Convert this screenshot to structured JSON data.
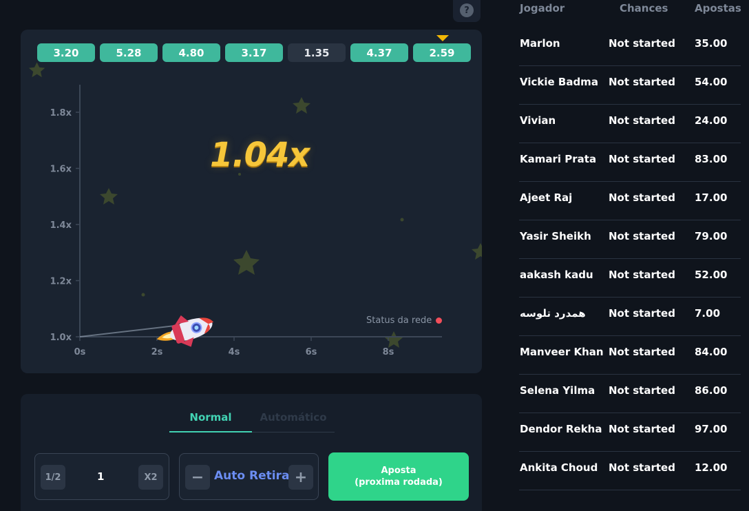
{
  "history": [
    "3.20",
    "5.28",
    "4.80",
    "3.17",
    "1.35",
    "4.37",
    "2.59"
  ],
  "help_label": "?",
  "multiplier": "1.04x",
  "status_label": "Status da rede",
  "chart_data": {
    "type": "line",
    "y_ticks": [
      "1.8x",
      "1.6x",
      "1.4x",
      "1.2x",
      "1.0x"
    ],
    "x_ticks": [
      "0s",
      "2s",
      "4s",
      "6s",
      "8s"
    ],
    "ylim": [
      1.0,
      1.8
    ],
    "x": [
      0,
      2.5
    ],
    "y": [
      1.0,
      1.04
    ]
  },
  "tabs": {
    "normal": "Normal",
    "auto": "Automático"
  },
  "bet": {
    "half_label": "1/2",
    "amount": "1",
    "double_label": "X2",
    "minus_label": "−",
    "auto_label": "Auto Retirar",
    "plus_label": "+",
    "bet_label_1": "Aposta",
    "bet_label_2": "(proxima rodada)"
  },
  "players": {
    "headers": [
      "Jogador",
      "Chances",
      "Apostas"
    ],
    "rows": [
      [
        "Marlon",
        "Not started",
        "35.00"
      ],
      [
        "Vickie Badma",
        "Not started",
        "54.00"
      ],
      [
        "Vivian",
        "Not started",
        "24.00"
      ],
      [
        "Kamari Prata",
        "Not started",
        "83.00"
      ],
      [
        "Ajeet Raj",
        "Not started",
        "17.00"
      ],
      [
        "Yasir Sheikh",
        "Not started",
        "79.00"
      ],
      [
        "aakash kadu",
        "Not started",
        "52.00"
      ],
      [
        "همدرد تلوسه",
        "Not started",
        "7.00"
      ],
      [
        "Manveer Khan",
        "Not started",
        "84.00"
      ],
      [
        "Selena Yilma",
        "Not started",
        "86.00"
      ],
      [
        "Dendor Rekha",
        "Not started",
        "97.00"
      ],
      [
        "Ankita Choud",
        "Not started",
        "12.00"
      ]
    ]
  },
  "colors": {
    "accent": "#42d3b3",
    "pill_green": "#3fb89c",
    "bet_green": "#2fd48a",
    "multiplier": "#f6c63a",
    "status_dot": "#f24e5a"
  }
}
